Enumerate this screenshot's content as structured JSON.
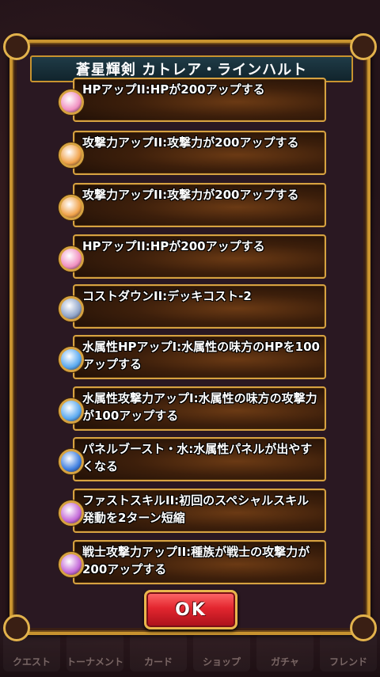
{
  "dialog": {
    "title": "蒼星輝剣 カトレア・ラインハルト",
    "skills": [
      {
        "text": "HPアップII:HPが200アップする",
        "icon": "hp-up-icon",
        "color": "#f08fc0"
      },
      {
        "text": "攻撃力アップII:攻撃力が200アップする",
        "icon": "attack-up-icon",
        "color": "#f0a24a"
      },
      {
        "text": "攻撃力アップII:攻撃力が200アップする",
        "icon": "attack-up-icon",
        "color": "#f0a24a"
      },
      {
        "text": "HPアップII:HPが200アップする",
        "icon": "hp-up-icon",
        "color": "#f08fc0"
      },
      {
        "text": "コストダウンII:デッキコスト-2",
        "icon": "cost-down-icon",
        "color": "#8fa4c8"
      },
      {
        "text": "水属性HPアップI:水属性の味方のHPを100アップする",
        "icon": "water-hp-up-icon",
        "color": "#5aa9f0"
      },
      {
        "text": "水属性攻撃力アップI:水属性の味方の攻撃力が100アップする",
        "icon": "water-attack-up-icon",
        "color": "#5aa9f0"
      },
      {
        "text": "パネルブースト・水:水属性パネルが出やすくなる",
        "icon": "panel-boost-water-icon",
        "color": "#3f7fe0"
      },
      {
        "text": "ファストスキルII:初回のスペシャルスキル発動を2ターン短縮",
        "icon": "fast-skill-icon",
        "color": "#c46ad8"
      },
      {
        "text": "戦士攻撃力アップII:種族が戦士の攻撃力が200アップする",
        "icon": "warrior-attack-up-icon",
        "color": "#c46ad8"
      }
    ],
    "ok_label": "OK"
  },
  "bottom_nav": [
    "クエスト",
    "トーナメント",
    "カード",
    "ショップ",
    "ガチャ",
    "フレンド"
  ]
}
